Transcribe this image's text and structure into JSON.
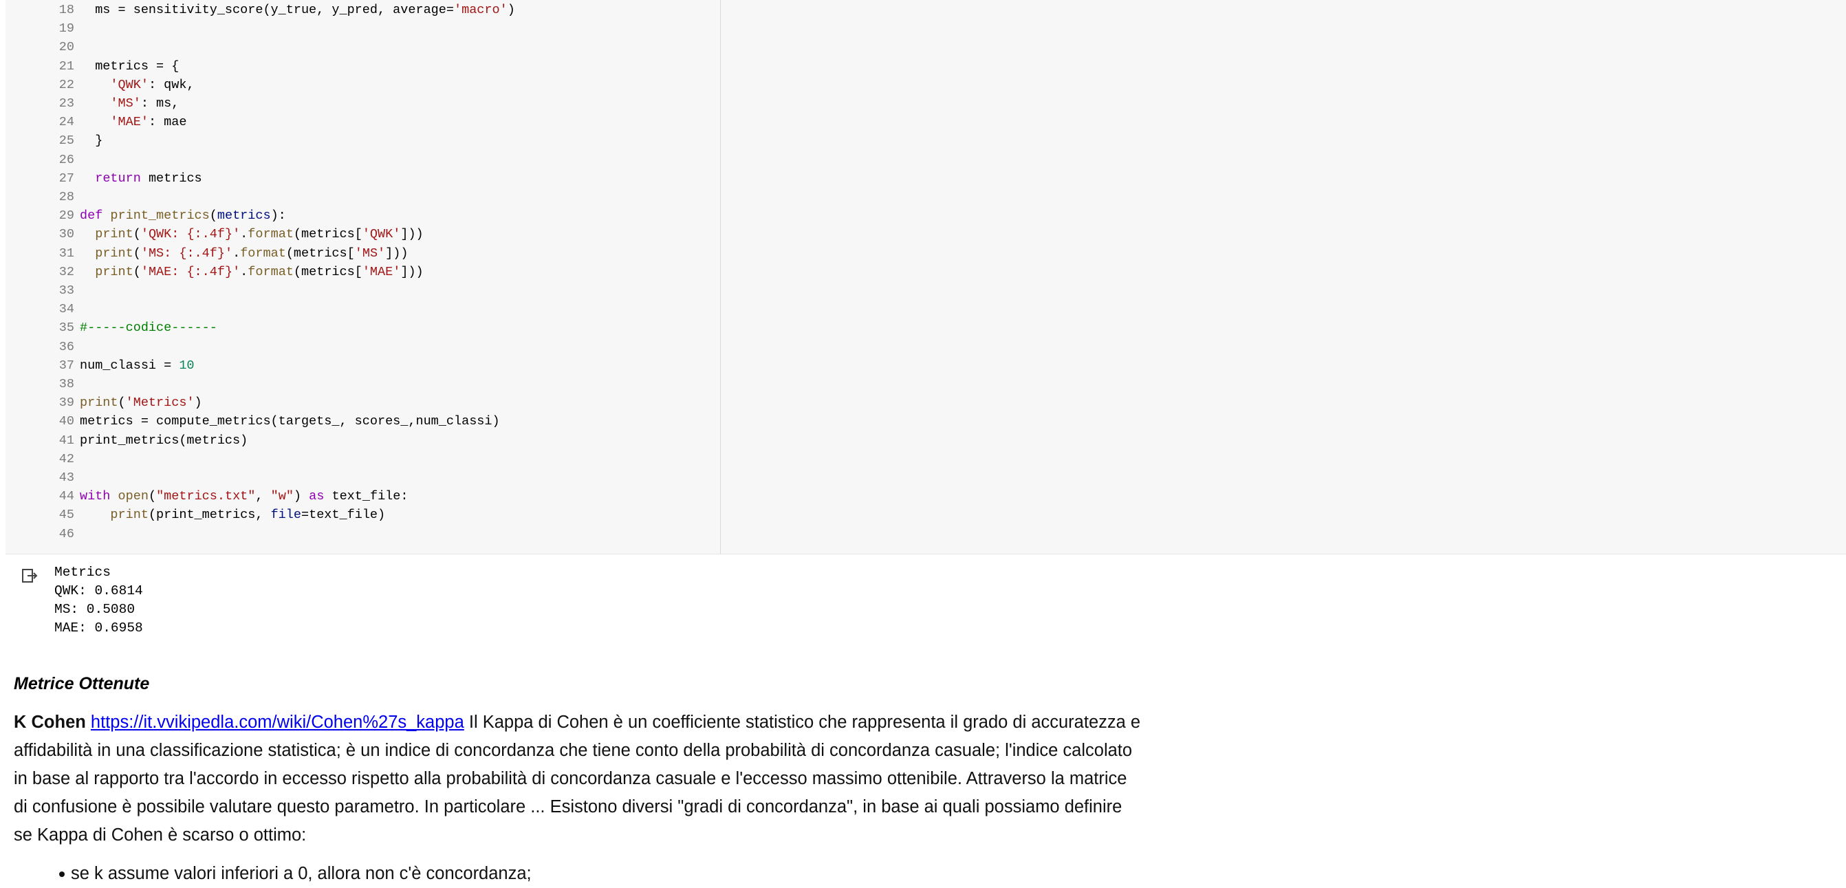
{
  "code": {
    "lines": [
      {
        "n": "18",
        "parts": [
          [
            "",
            "  ms = sensitivity_score(y_true, y_pred, average="
          ],
          [
            "str",
            "'macro'"
          ],
          [
            "",
            ")"
          ]
        ]
      },
      {
        "n": "19",
        "parts": [
          [
            "",
            ""
          ]
        ]
      },
      {
        "n": "20",
        "parts": [
          [
            "",
            ""
          ]
        ]
      },
      {
        "n": "21",
        "parts": [
          [
            "",
            "  metrics = {"
          ]
        ]
      },
      {
        "n": "22",
        "parts": [
          [
            "",
            "    "
          ],
          [
            "str",
            "'QWK'"
          ],
          [
            "",
            ": qwk,"
          ]
        ]
      },
      {
        "n": "23",
        "parts": [
          [
            "",
            "    "
          ],
          [
            "str",
            "'MS'"
          ],
          [
            "",
            ": ms,"
          ]
        ]
      },
      {
        "n": "24",
        "parts": [
          [
            "",
            "    "
          ],
          [
            "str",
            "'MAE'"
          ],
          [
            "",
            ": mae"
          ]
        ]
      },
      {
        "n": "25",
        "parts": [
          [
            "",
            "  }"
          ]
        ]
      },
      {
        "n": "26",
        "parts": [
          [
            "",
            ""
          ]
        ]
      },
      {
        "n": "27",
        "parts": [
          [
            "",
            "  "
          ],
          [
            "kw",
            "return"
          ],
          [
            "",
            " metrics"
          ]
        ]
      },
      {
        "n": "28",
        "parts": [
          [
            "",
            ""
          ]
        ]
      },
      {
        "n": "29",
        "parts": [
          [
            "kw",
            "def"
          ],
          [
            "",
            " "
          ],
          [
            "fn",
            "print_metrics"
          ],
          [
            "",
            "("
          ],
          [
            "var",
            "metrics"
          ],
          [
            "",
            "):"
          ]
        ]
      },
      {
        "n": "30",
        "parts": [
          [
            "",
            "  "
          ],
          [
            "fn",
            "print"
          ],
          [
            "",
            "("
          ],
          [
            "str",
            "'QWK: {:.4f}'"
          ],
          [
            "",
            "."
          ],
          [
            "fn",
            "format"
          ],
          [
            "",
            "(metrics["
          ],
          [
            "str",
            "'QWK'"
          ],
          [
            "",
            "]))"
          ]
        ]
      },
      {
        "n": "31",
        "parts": [
          [
            "",
            "  "
          ],
          [
            "fn",
            "print"
          ],
          [
            "",
            "("
          ],
          [
            "str",
            "'MS: {:.4f}'"
          ],
          [
            "",
            "."
          ],
          [
            "fn",
            "format"
          ],
          [
            "",
            "(metrics["
          ],
          [
            "str",
            "'MS'"
          ],
          [
            "",
            "]))"
          ]
        ]
      },
      {
        "n": "32",
        "parts": [
          [
            "",
            "  "
          ],
          [
            "fn",
            "print"
          ],
          [
            "",
            "("
          ],
          [
            "str",
            "'MAE: {:.4f}'"
          ],
          [
            "",
            "."
          ],
          [
            "fn",
            "format"
          ],
          [
            "",
            "(metrics["
          ],
          [
            "str",
            "'MAE'"
          ],
          [
            "",
            "]))"
          ]
        ]
      },
      {
        "n": "33",
        "parts": [
          [
            "",
            ""
          ]
        ]
      },
      {
        "n": "34",
        "parts": [
          [
            "",
            ""
          ]
        ]
      },
      {
        "n": "35",
        "parts": [
          [
            "cmt",
            "#-----codice------"
          ]
        ]
      },
      {
        "n": "36",
        "parts": [
          [
            "",
            ""
          ]
        ]
      },
      {
        "n": "37",
        "parts": [
          [
            "",
            "num_classi = "
          ],
          [
            "num",
            "10"
          ]
        ]
      },
      {
        "n": "38",
        "parts": [
          [
            "",
            ""
          ]
        ]
      },
      {
        "n": "39",
        "parts": [
          [
            "fn",
            "print"
          ],
          [
            "",
            "("
          ],
          [
            "str",
            "'Metrics'"
          ],
          [
            "",
            ")"
          ]
        ]
      },
      {
        "n": "40",
        "parts": [
          [
            "",
            "metrics = compute_metrics(targets_, scores_,num_classi)"
          ]
        ]
      },
      {
        "n": "41",
        "parts": [
          [
            "",
            "print_metrics(metrics)"
          ]
        ]
      },
      {
        "n": "42",
        "parts": [
          [
            "",
            ""
          ]
        ]
      },
      {
        "n": "43",
        "parts": [
          [
            "",
            ""
          ]
        ]
      },
      {
        "n": "44",
        "parts": [
          [
            "kw",
            "with"
          ],
          [
            "",
            " "
          ],
          [
            "fn",
            "open"
          ],
          [
            "",
            "("
          ],
          [
            "str",
            "\"metrics.txt\""
          ],
          [
            "",
            ", "
          ],
          [
            "str",
            "\"w\""
          ],
          [
            "",
            ") "
          ],
          [
            "kw",
            "as"
          ],
          [
            "",
            " text_file:"
          ]
        ]
      },
      {
        "n": "45",
        "parts": [
          [
            "",
            "    "
          ],
          [
            "fn",
            "print"
          ],
          [
            "",
            "(print_metrics, "
          ],
          [
            "var",
            "file"
          ],
          [
            "",
            "=text_file)"
          ]
        ]
      },
      {
        "n": "46",
        "parts": [
          [
            "",
            ""
          ]
        ]
      }
    ]
  },
  "output": {
    "icon": "output-arrow-icon",
    "lines": [
      "Metrics",
      "QWK: 0.6814",
      "MS: 0.5080",
      "MAE: 0.6958"
    ]
  },
  "text_cell": {
    "heading": "Metrice Ottenute",
    "para_bold": "K Cohen",
    "para_link": "https://it.vvikipedla.com/wiki/Cohen%27s_kappa",
    "para_text": " Il Kappa di Cohen è un coefficiente statistico che rappresenta il grado di accuratezza e affidabilità in una classificazione statistica; è un indice di concordanza che tiene conto della probabilità di concordanza casuale; l'indice calcolato in base al rapporto tra l'accordo in eccesso rispetto alla probabilità di concordanza casuale e l'eccesso massimo ottenibile. Attraverso la matrice di confusione è possibile valutare questo parametro. In particolare ... Esistono diversi \"gradi di concordanza\", in base ai quali possiamo definire se Kappa di Cohen è scarso o ottimo:",
    "list_items": [
      "se k assume valori inferiori a 0, allora non c'è concordanza;"
    ]
  }
}
